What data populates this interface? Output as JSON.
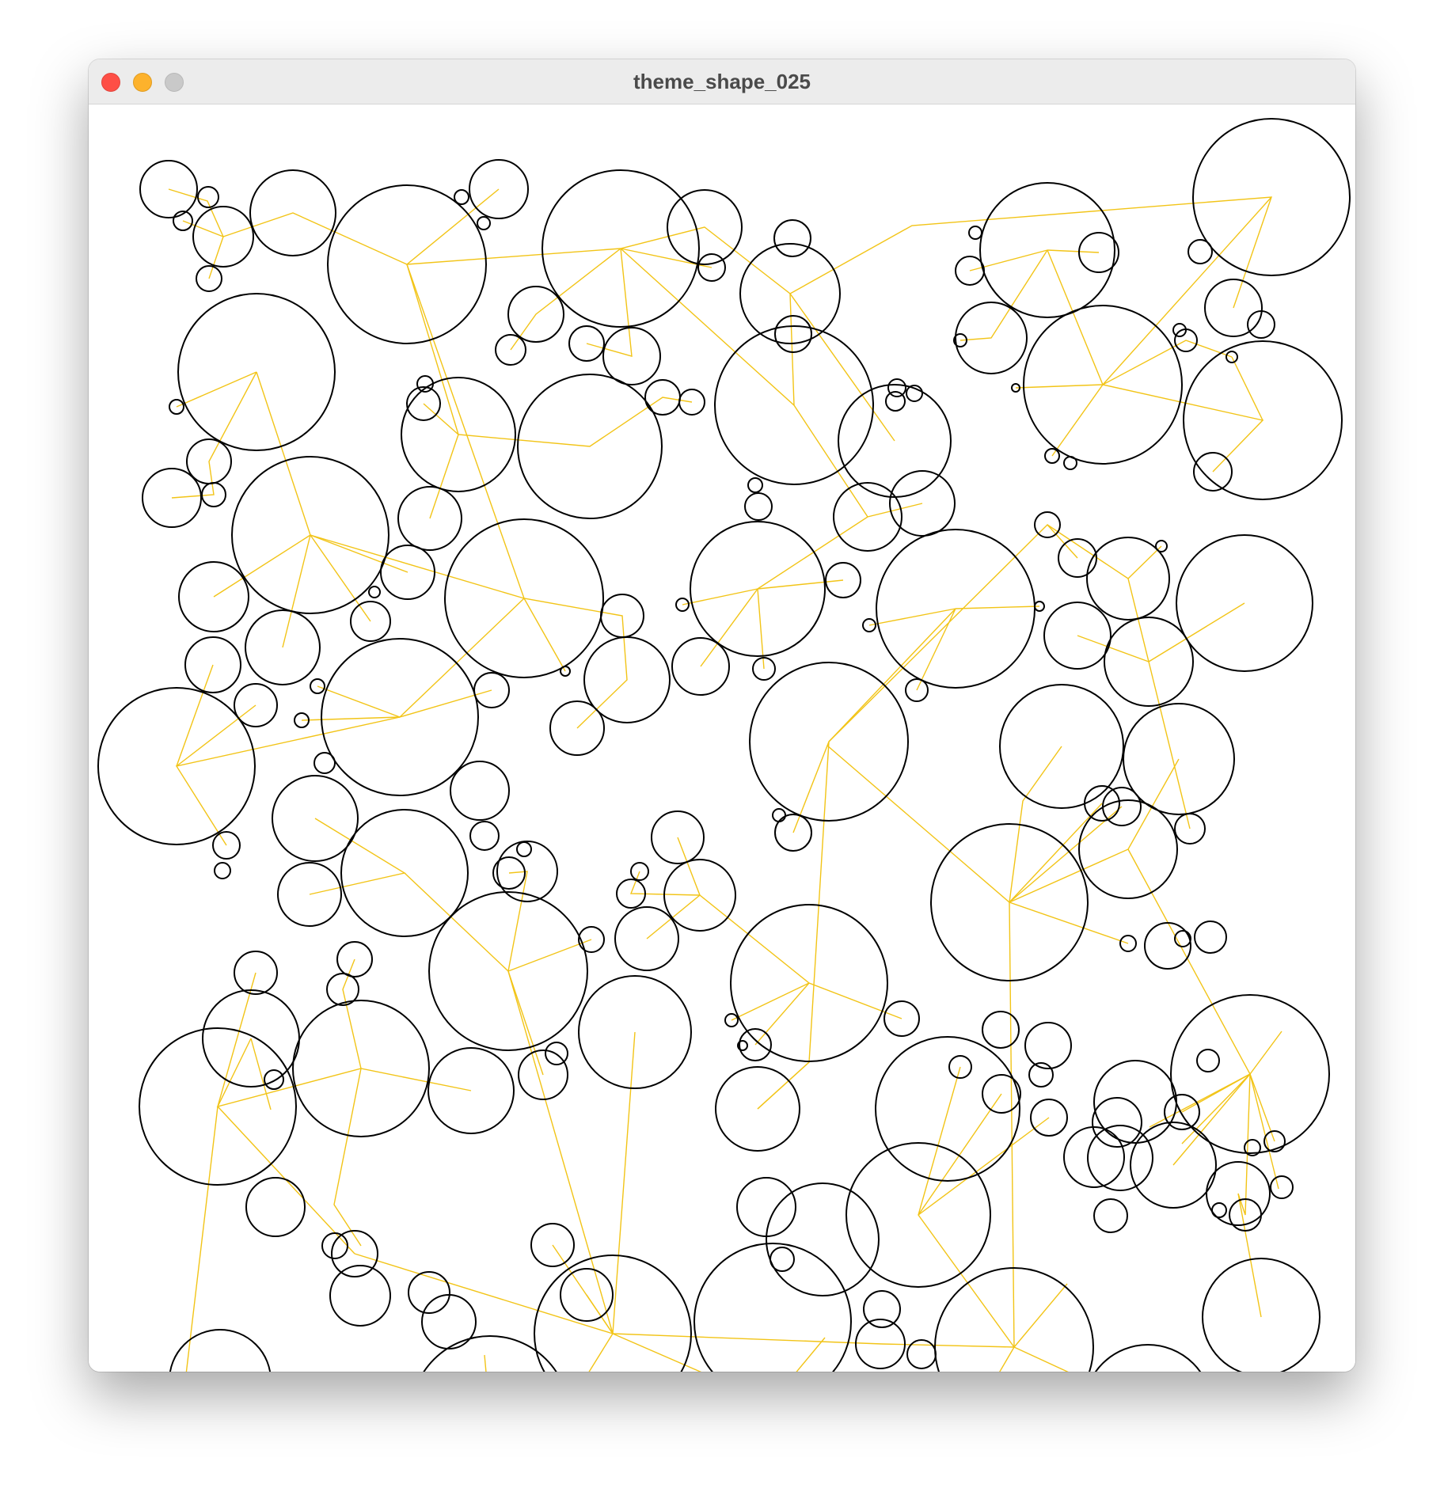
{
  "window": {
    "title": "theme_shape_025"
  },
  "controls": {
    "close": "close-icon",
    "minimize": "minimize-icon",
    "zoom": "zoom-icon"
  },
  "colors": {
    "titlebar": "#ececec",
    "close": "#fe4f46",
    "minimize": "#fdb22c",
    "zoom": "#c9c9c9",
    "circle_stroke": "#000000",
    "connector": "#f2c417",
    "background": "#ffffff"
  }
}
